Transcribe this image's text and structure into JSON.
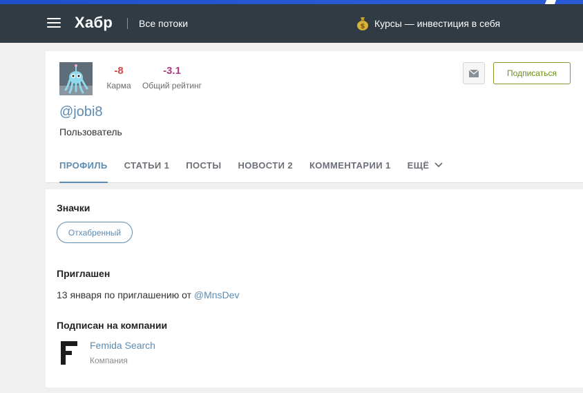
{
  "header": {
    "logo": "Хабр",
    "streams_label": "Все потоки",
    "promo_text": "Курсы — инвестиция в себя",
    "promo_icon": "money-bag-icon"
  },
  "profile": {
    "karma_value": "-8",
    "karma_label": "Карма",
    "rating_value": "-3.1",
    "rating_label": "Общий рейтинг",
    "username": "@jobi8",
    "role": "Пользователь",
    "subscribe_label": "Подписаться",
    "colors": {
      "karma": "#d04747",
      "rating": "#b03a82",
      "accent": "#5e8bb1",
      "subscribe": "#6c8c1c"
    }
  },
  "tabs": [
    {
      "label": "ПРОФИЛЬ",
      "active": true
    },
    {
      "label": "СТАТЬИ 1"
    },
    {
      "label": "ПОСТЫ"
    },
    {
      "label": "НОВОСТИ 2"
    },
    {
      "label": "КОММЕНТАРИИ 1"
    },
    {
      "label": "ЕЩЁ"
    }
  ],
  "badges": {
    "title": "Значки",
    "items": [
      "Отхабренный"
    ]
  },
  "invited": {
    "title": "Приглашен",
    "text": "13 января по приглашению от ",
    "inviter": "@MnsDev"
  },
  "companies": {
    "title": "Подписан на компании",
    "items": [
      {
        "name": "Femida Search",
        "type": "Компания"
      }
    ]
  }
}
